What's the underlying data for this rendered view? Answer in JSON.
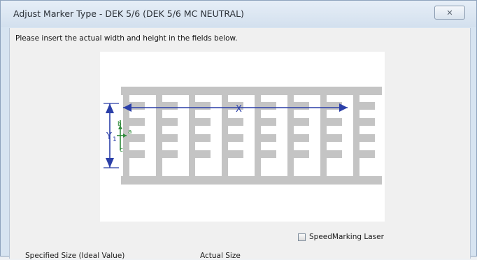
{
  "window": {
    "title": "Adjust Marker Type - DEK 5/6 (DEK 5/6 MC NEUTRAL)",
    "close_glyph": "✕"
  },
  "instruction": "Please insert the actual width and height in the fields below.",
  "diagram": {
    "x_label": "X",
    "y_label": "Y",
    "y_sub": "1",
    "b_label": "b",
    "a_label": "a",
    "c_label": "c",
    "dimension_color": "#2b3fa8",
    "marker_color": "#c4c4c4",
    "origin_color": "#2e8b3a"
  },
  "speed_marking": {
    "label": "SpeedMarking Laser",
    "checked": false
  },
  "fields": {
    "specified_label": "Specified Size (Ideal Value)",
    "actual_label": "Actual Size"
  }
}
